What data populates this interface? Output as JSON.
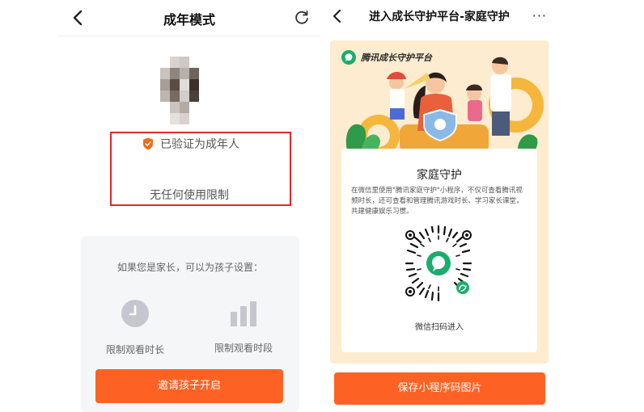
{
  "left_screen": {
    "title": "成年模式",
    "verified_text": "已验证为成年人",
    "no_limit_text": "无任何使用限制",
    "parent_hint": "如果您是家长，可以为孩子设置：",
    "features": [
      {
        "label": "限制观看时长",
        "icon": "clock-icon"
      },
      {
        "label": "限制观看时段",
        "icon": "bar-chart-icon"
      }
    ],
    "invite_button": "邀请孩子开启",
    "accent_color": "#fd6224",
    "highlight_color": "#e4262c"
  },
  "right_screen": {
    "title": "进入成长守护平台-家庭守护",
    "more": "···",
    "brand_name": "腾讯成长守护平台",
    "card_title": "家庭守护",
    "card_desc": "在微信里使用\"腾讯家庭守护\"小程序，不仅可查看腾讯视频时长，还可查看和管理腾讯游戏时长、学习家长课堂，共建健康娱乐习惯。",
    "scan_text": "微信扫码进入",
    "save_button": "保存小程序码图片",
    "panel_color": "#fdeccf",
    "brand_color": "#1aad6e"
  }
}
